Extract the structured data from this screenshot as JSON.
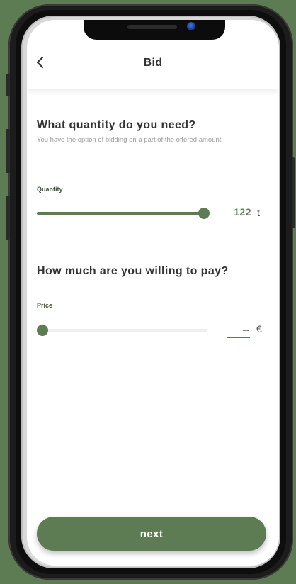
{
  "header": {
    "title": "Bid",
    "back_icon": "chevron-left-icon"
  },
  "quantity_section": {
    "heading": "What quantity do you need?",
    "subtitle": "You have the option of bidding on a part of the offered amount",
    "field_label": "Quantity",
    "value": "122",
    "unit": "t",
    "slider_fraction": 1.0
  },
  "price_section": {
    "heading": "How much are you willing to pay?",
    "field_label": "Price",
    "value": "--",
    "unit": "€",
    "slider_fraction": 0.0
  },
  "footer": {
    "next_label": "next"
  },
  "colors": {
    "accent": "#5d7c54",
    "background": "#5d7c54",
    "screen": "#ffffff"
  }
}
